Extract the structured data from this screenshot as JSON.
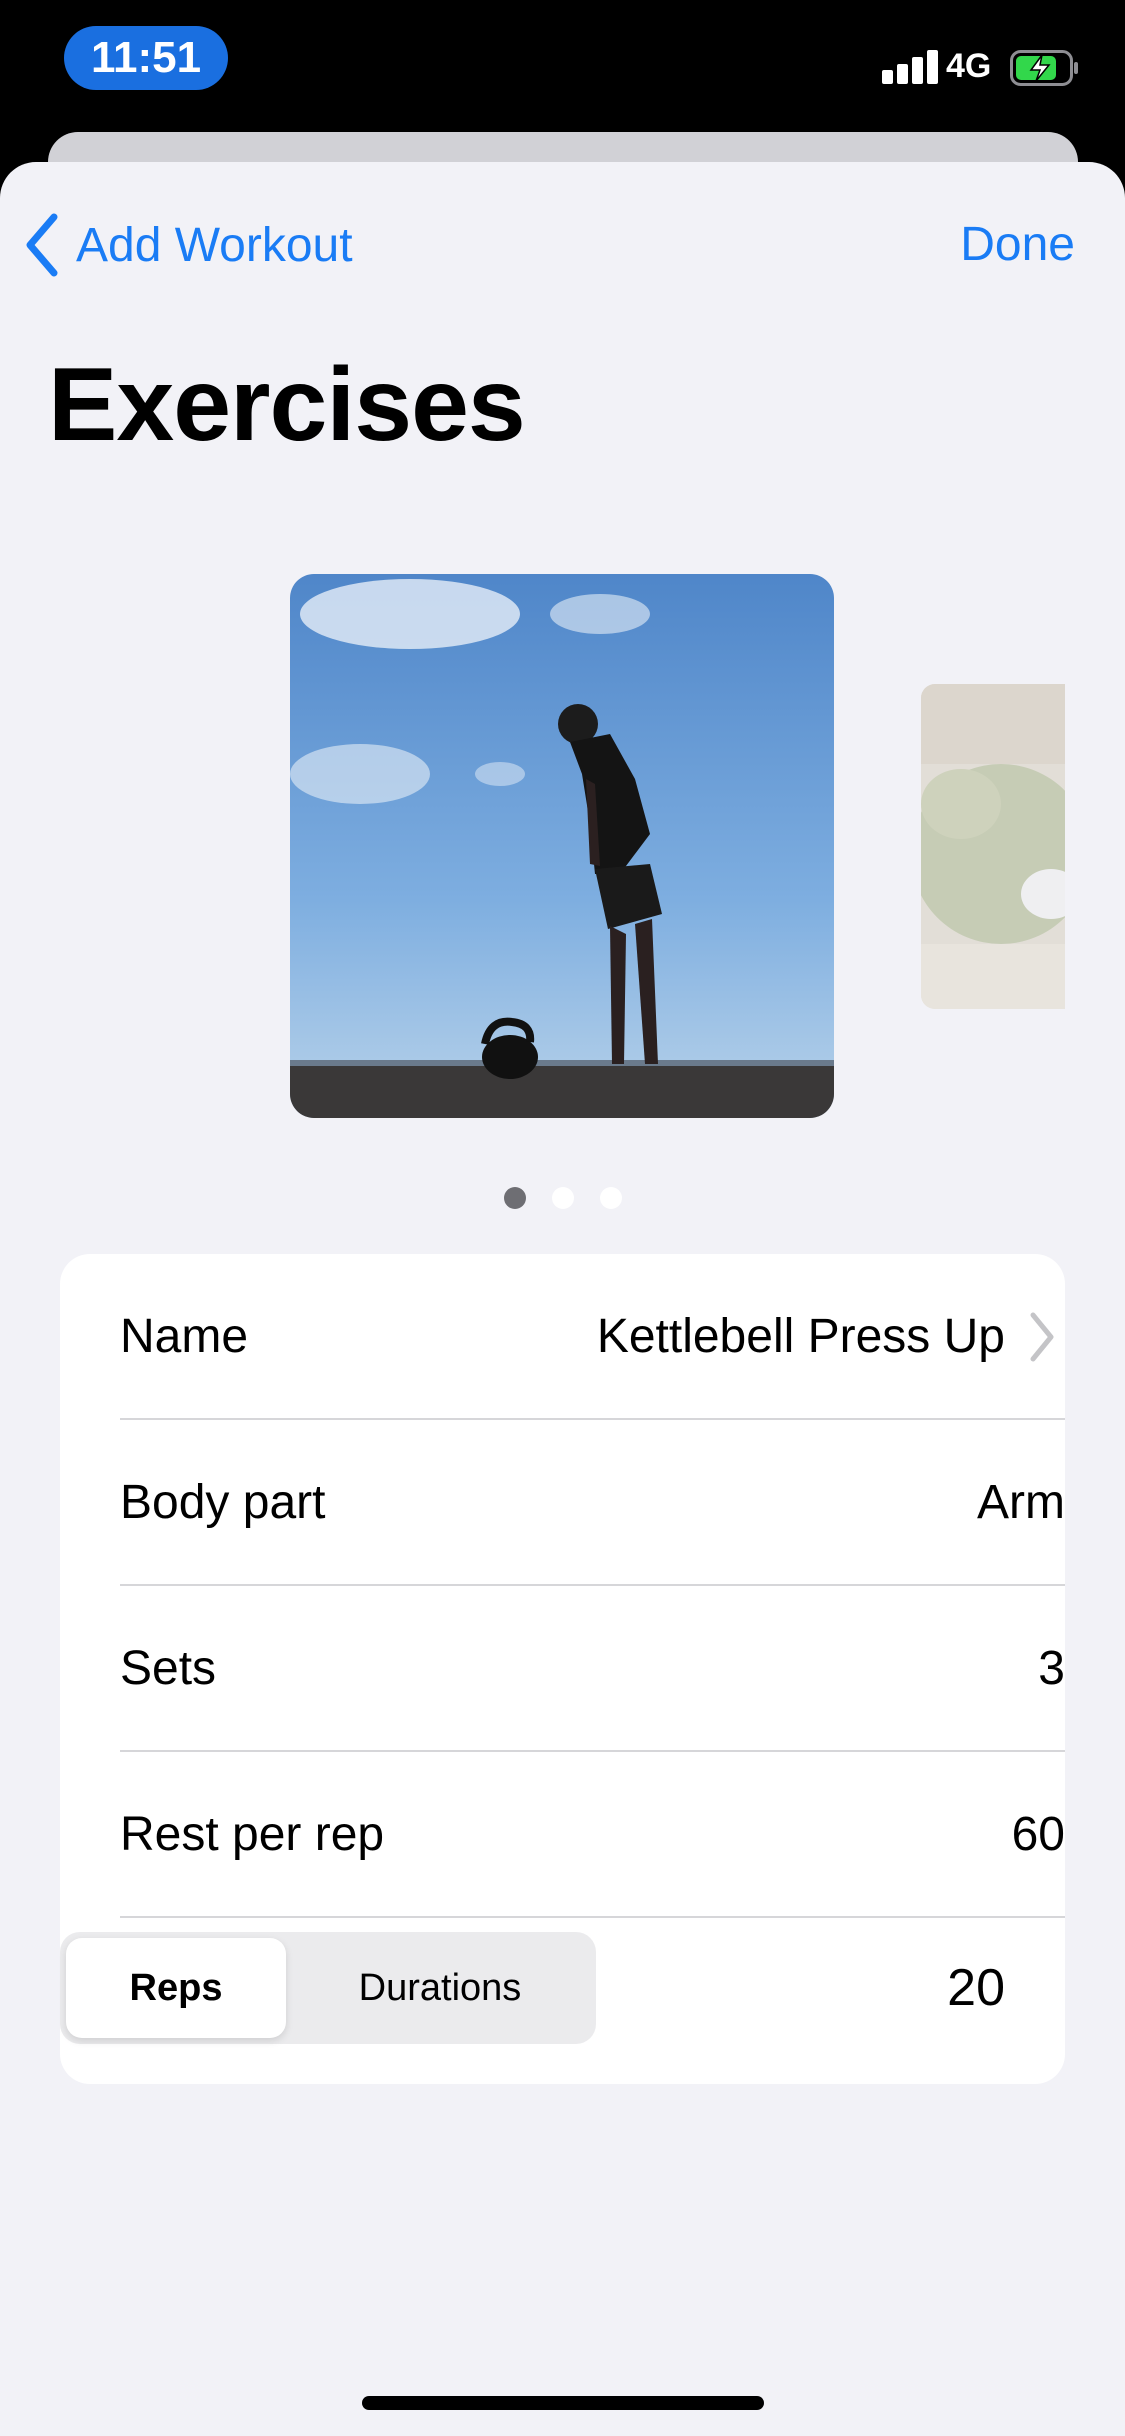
{
  "status_bar": {
    "time": "11:51",
    "network": "4G",
    "icons": [
      "signal-icon",
      "battery-charging-icon"
    ],
    "accent": "#1a6fe0"
  },
  "nav": {
    "back_label": "Add Workout",
    "done_label": "Done",
    "tint": "#1a7cf5"
  },
  "page": {
    "title": "Exercises"
  },
  "carousel": {
    "page_count": 3,
    "current_page": 1
  },
  "form": {
    "name": {
      "label": "Name",
      "value": "Kettlebell Press Up"
    },
    "body_part": {
      "label": "Body part",
      "value": "Arm"
    },
    "sets": {
      "label": "Sets",
      "value": "3"
    },
    "rest": {
      "label": "Rest per rep",
      "value": "60"
    },
    "mode": {
      "options": [
        "Reps",
        "Durations"
      ],
      "selected": "Reps",
      "value": "20"
    }
  }
}
